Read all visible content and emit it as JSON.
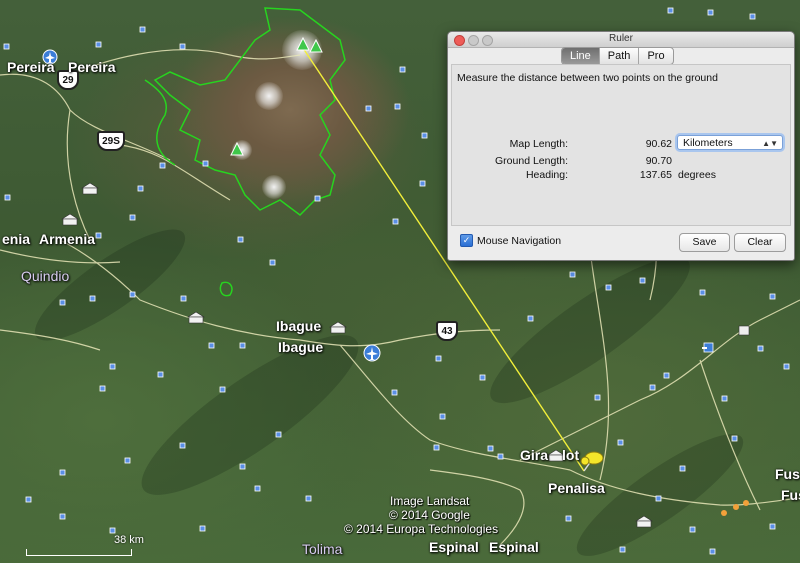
{
  "ruler": {
    "window_title": "Ruler",
    "tabs": [
      {
        "label": "Line",
        "active": true
      },
      {
        "label": "Path",
        "active": false
      },
      {
        "label": "Pro",
        "active": false
      }
    ],
    "instructions": "Measure the distance between two points on the ground",
    "map_length_label": "Map Length:",
    "map_length_value": "90.62",
    "unit_selected": "Kilometers",
    "ground_length_label": "Ground Length:",
    "ground_length_value": "90.70",
    "heading_label": "Heading:",
    "heading_value": "137.65",
    "heading_unit": "degrees",
    "mouse_nav_label": "Mouse Navigation",
    "mouse_nav_checked": true,
    "save_label": "Save",
    "clear_label": "Clear"
  },
  "map": {
    "places": {
      "pereira": "Pereira",
      "pereira_2": "Pereira",
      "armenia": "enia",
      "armenia_2": "Armenia",
      "quindio": "Quindio",
      "ibague": "Ibague",
      "ibague_2": "Ibague",
      "girardot": "Gira",
      "girardot_2": "lot",
      "penalisa": "Penalisa",
      "espinal": "Espinal",
      "espinal_2": "Espinal",
      "tolima": "Tolima",
      "fus_1": "Fus",
      "fus_2": "Fus"
    },
    "shields": [
      "29",
      "29S",
      "43"
    ],
    "scale_label": "38 km",
    "credits": [
      "Image Landsat",
      "© 2014 Google",
      "© 2014 Europa Technologies"
    ],
    "colors": {
      "measure_line": "#f2ef3a",
      "boundary": "#27d41f",
      "road": "#e8e6b8",
      "poi": "#5a8fe6"
    },
    "icons": [
      "airport-icon",
      "museum-icon",
      "park-icon",
      "pushpin-icon",
      "hospital-icon"
    ]
  }
}
